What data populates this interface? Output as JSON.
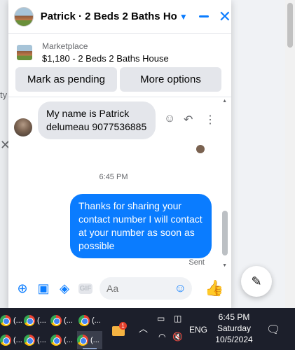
{
  "background": {
    "partial_text": "ty"
  },
  "chat": {
    "title": "Patrick · 2 Beds 2 Baths Ho...",
    "listing": {
      "category": "Marketplace",
      "description": "$1,180 - 2 Beds 2 Baths House"
    },
    "actions": {
      "mark_pending": "Mark as pending",
      "more_options": "More options"
    },
    "messages": {
      "incoming_text": "My name is Patrick delumeau 9077536885",
      "timestamp": "6:45 PM",
      "outgoing_text": "Thanks for sharing your contact number I will contact at your number as soon as possible",
      "status": "Sent"
    },
    "composer": {
      "placeholder": "Aa",
      "gif_label": "GIF"
    }
  },
  "taskbar": {
    "tray_language": "ENG",
    "badge_count": "1",
    "clock_time": "6:45 PM",
    "clock_day": "Saturday",
    "clock_date": "10/5/2024",
    "button_label": "(..."
  },
  "colors": {
    "accent": "#0a7cff",
    "bubble_in": "#e4e6eb",
    "taskbar": "#1c1f2b"
  }
}
